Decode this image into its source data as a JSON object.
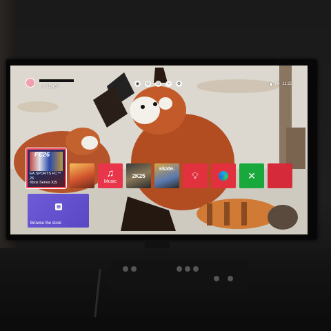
{
  "profile": {
    "points": "11,450"
  },
  "status_bar": {
    "battery": "80",
    "time": "11:23"
  },
  "top_icons": [
    "party",
    "people",
    "messages",
    "notifications",
    "settings"
  ],
  "featured_tile": {
    "logo": "FC26",
    "title_line1": "EA SPORTS FC™ 26",
    "title_line2": "Xbox Series X|S"
  },
  "tiles": {
    "music_label": "Music",
    "nba_label": "2K25",
    "skate_label": "skate."
  },
  "store": {
    "label": "Browse the store"
  },
  "colors": {
    "focus_border": "#ff4a63",
    "store_card": "#6e5bd6",
    "app_red": "#e1303e",
    "gamepass_green": "#19a83c"
  }
}
